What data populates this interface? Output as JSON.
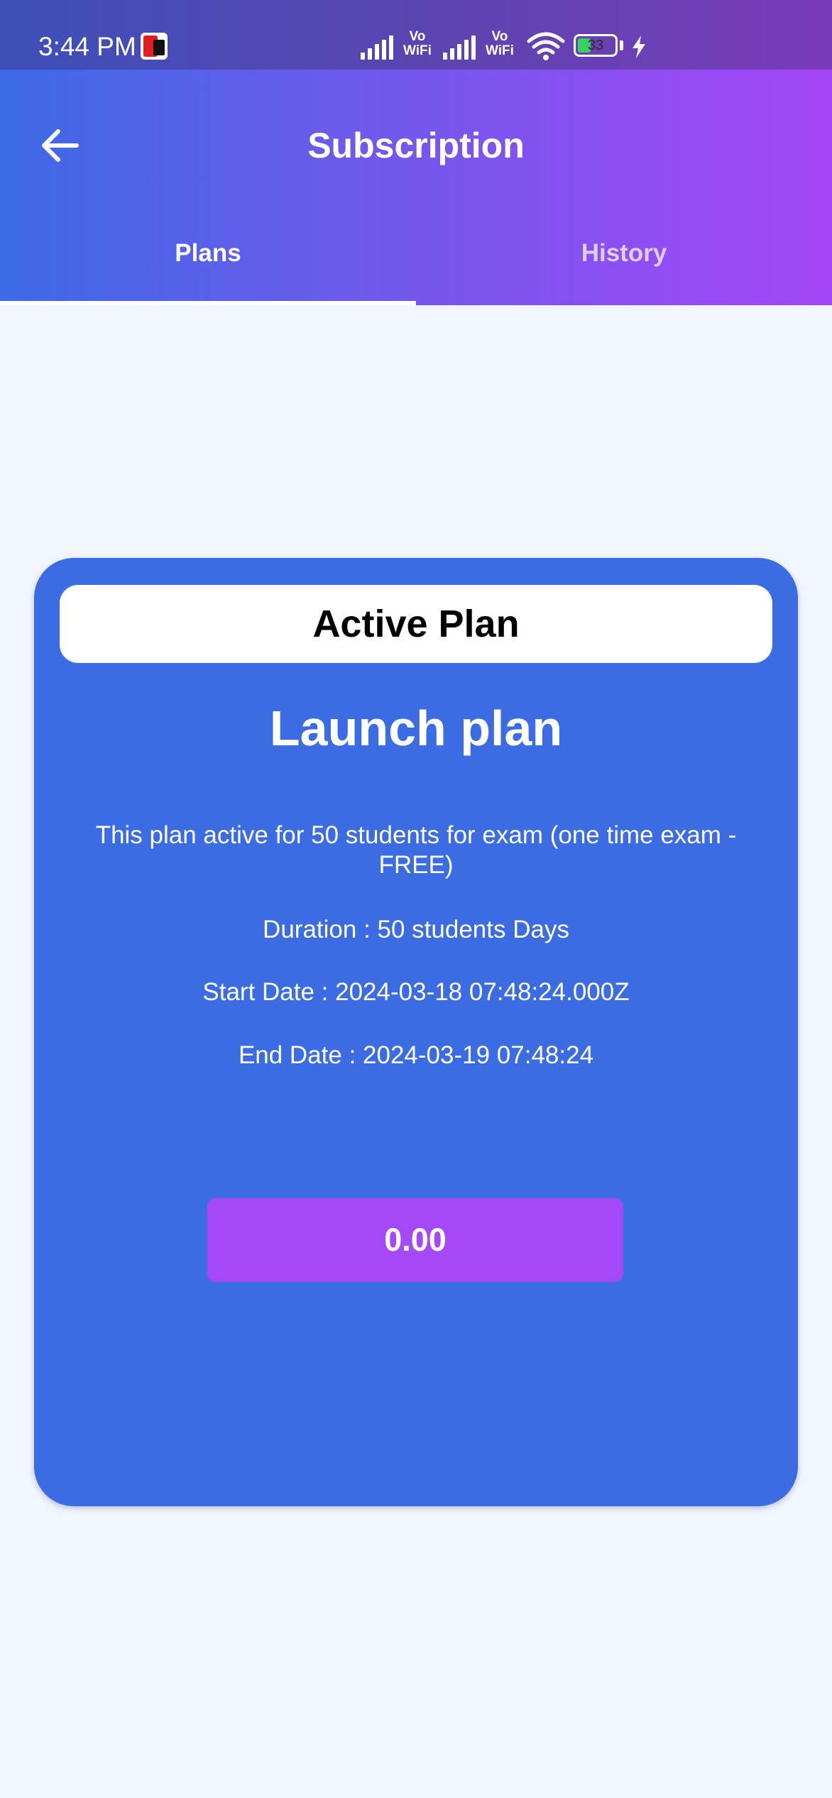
{
  "status_bar": {
    "time": "3:44 PM",
    "vowifi_1_top": "Vo",
    "vowifi_1_bottom": "WiFi",
    "vowifi_2_top": "Vo",
    "vowifi_2_bottom": "WiFi",
    "battery_level": "33",
    "icons": [
      "app-notification-icon",
      "signal-icon",
      "signal-icon",
      "wifi-icon",
      "battery-icon",
      "charging-bolt-icon"
    ]
  },
  "header": {
    "title": "Subscription",
    "back_icon": "arrow-left-icon"
  },
  "tabs": [
    {
      "label": "Plans",
      "selected": true
    },
    {
      "label": "History",
      "selected": false
    }
  ],
  "active_plan": {
    "badge": "Active Plan",
    "name": "Launch plan",
    "description": "This plan active for 50 students for exam (one time exam - FREE)",
    "duration": "Duration : 50 students Days",
    "start_date": "Start Date : 2024-03-18 07:48:24.000Z",
    "end_date": "End Date : 2024-03-19 07:48:24",
    "price": "0.00"
  },
  "colors": {
    "header_gradient_start": "#3c6ae6",
    "header_gradient_end": "#a446f7",
    "card_background": "#3c6ce4",
    "price_button": "#a448f8",
    "page_background": "#f1f6fe"
  }
}
